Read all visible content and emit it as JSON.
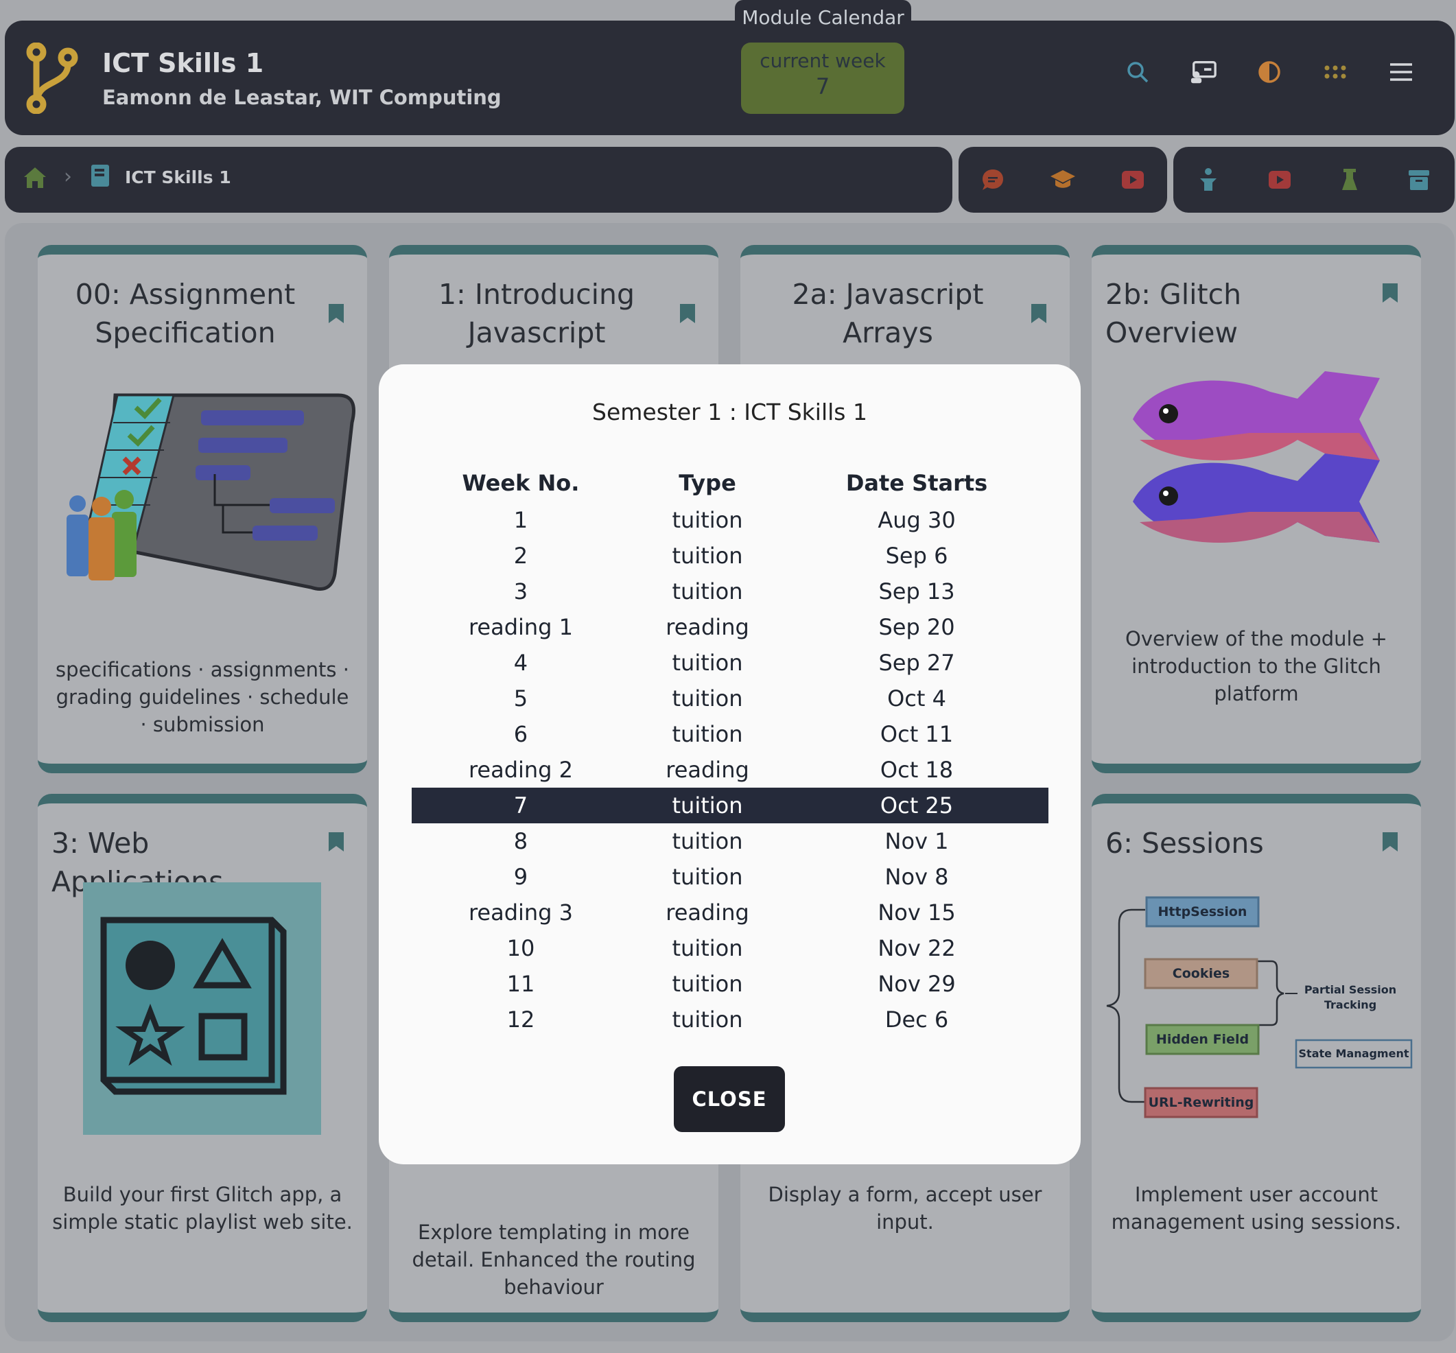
{
  "header": {
    "title": "ICT Skills 1",
    "subtitle": "Eamonn de Leastar, WIT Computing",
    "calendar": {
      "tab_label": "Module Calendar",
      "week_label": "current week",
      "week_value": "7"
    },
    "icons": [
      "search-icon",
      "presentation-icon",
      "contrast-icon",
      "apps-grid-icon",
      "menu-icon"
    ]
  },
  "breadcrumb": {
    "label": "ICT Skills 1"
  },
  "toolbar": {
    "group1": [
      "chat-icon",
      "graduation-cap-icon",
      "video-icon"
    ],
    "group2": [
      "lecturer-icon",
      "video-icon",
      "lab-icon",
      "archive-icon"
    ]
  },
  "cards": [
    {
      "title": "00: Assignment Specification",
      "desc": "specifications · assignments · grading guidelines · schedule · submission"
    },
    {
      "title": "1: Introducing Javascript",
      "desc": ""
    },
    {
      "title": "2a: Javascript Arrays",
      "desc": ""
    },
    {
      "title": "2b: Glitch Overview",
      "desc": "Overview of the module + introduction to the Glitch platform"
    },
    {
      "title": "3: Web Applications",
      "desc": "Build your first Glitch app, a simple static playlist web site."
    },
    {
      "title": "",
      "desc": "Explore templating in more detail. Enhanced the routing behaviour"
    },
    {
      "title": "",
      "desc": "Display a form, accept user input."
    },
    {
      "title": "6: Sessions",
      "desc": "Implement user account management using sessions."
    }
  ],
  "sessions_diagram": {
    "nodes": [
      "HttpSession",
      "Cookies",
      "Hidden Field",
      "URL-Rewriting"
    ],
    "group_label": "Partial Session Tracking",
    "box_label": "State Managment"
  },
  "modal": {
    "title": "Semester 1 : ICT Skills 1",
    "columns": [
      "Week No.",
      "Type",
      "Date Starts"
    ],
    "current_row": 8,
    "rows": [
      [
        "1",
        "tuition",
        "Aug 30"
      ],
      [
        "2",
        "tuition",
        "Sep 6"
      ],
      [
        "3",
        "tuition",
        "Sep 13"
      ],
      [
        "reading 1",
        "reading",
        "Sep 20"
      ],
      [
        "4",
        "tuition",
        "Sep 27"
      ],
      [
        "5",
        "tuition",
        "Oct 4"
      ],
      [
        "6",
        "tuition",
        "Oct 11"
      ],
      [
        "reading 2",
        "reading",
        "Oct 18"
      ],
      [
        "7",
        "tuition",
        "Oct 25"
      ],
      [
        "8",
        "tuition",
        "Nov 1"
      ],
      [
        "9",
        "tuition",
        "Nov 8"
      ],
      [
        "reading 3",
        "reading",
        "Nov 15"
      ],
      [
        "10",
        "tuition",
        "Nov 22"
      ],
      [
        "11",
        "tuition",
        "Nov 29"
      ],
      [
        "12",
        "tuition",
        "Dec 6"
      ]
    ],
    "close_label": "CLOSE"
  }
}
